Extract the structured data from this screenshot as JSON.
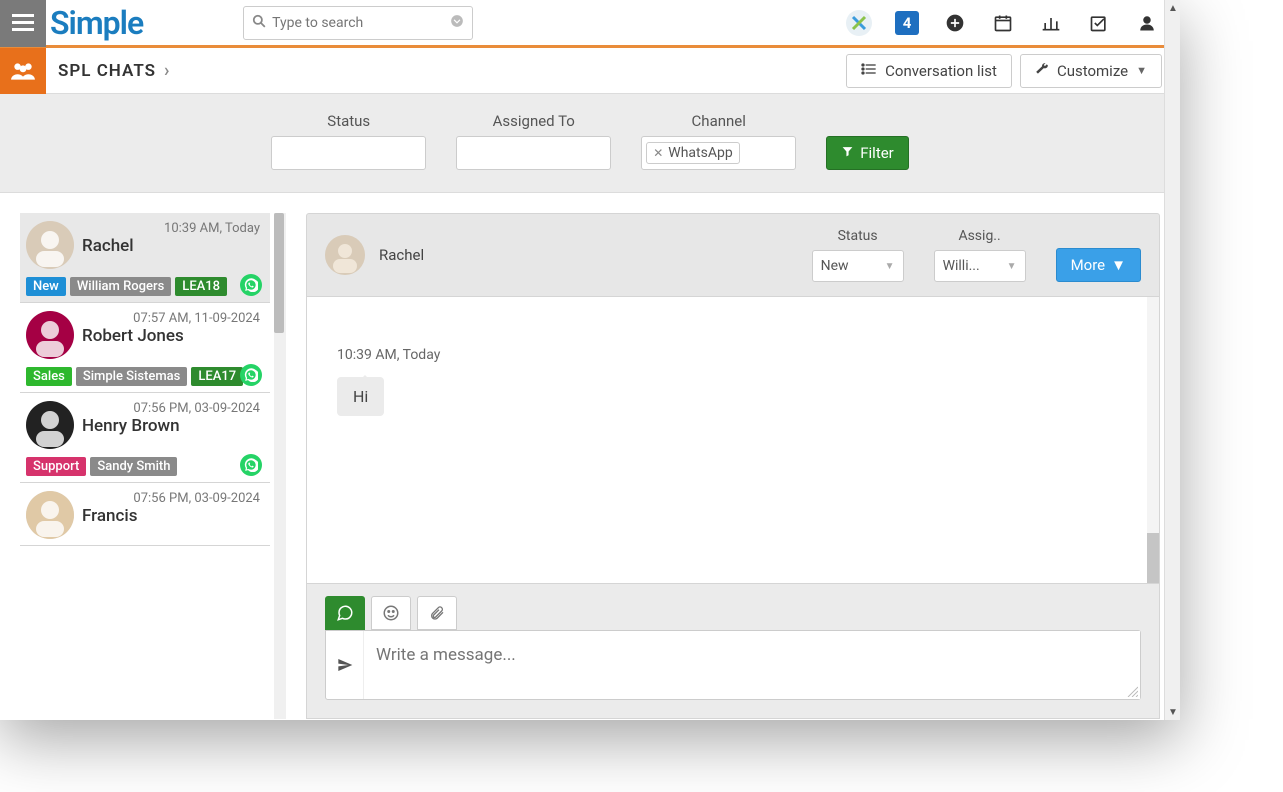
{
  "header": {
    "logo_text": "Simple",
    "search_placeholder": "Type to search"
  },
  "sub_header": {
    "title": "SPL CHATS",
    "conv_list_btn": "Conversation list",
    "customize_btn": "Customize"
  },
  "filters": {
    "status_label": "Status",
    "assigned_label": "Assigned To",
    "channel_label": "Channel",
    "channel_chip": "WhatsApp",
    "filter_btn": "Filter"
  },
  "conversations": [
    {
      "time": "10:39 AM, Today",
      "name": "Rachel",
      "tags": [
        {
          "text": "New",
          "cls": "tag-new"
        },
        {
          "text": "William Rogers",
          "cls": "tag-grey"
        },
        {
          "text": "LEA18",
          "cls": "tag-lea18"
        }
      ],
      "selected": true,
      "wa": true
    },
    {
      "time": "07:57 AM, 11-09-2024",
      "name": "Robert Jones",
      "tags": [
        {
          "text": "Sales",
          "cls": "tag-sales"
        },
        {
          "text": "Simple Sistemas",
          "cls": "tag-grey"
        },
        {
          "text": "LEA17",
          "cls": "tag-lea17"
        }
      ],
      "wa": true
    },
    {
      "time": "07:56 PM, 03-09-2024",
      "name": "Henry Brown",
      "tags": [
        {
          "text": "Support",
          "cls": "tag-support"
        },
        {
          "text": "Sandy Smith",
          "cls": "tag-grey"
        }
      ],
      "wa": true
    },
    {
      "time": "07:56 PM, 03-09-2024",
      "name": "Francis",
      "tags": [],
      "wa": false
    }
  ],
  "chat": {
    "contact_name": "Rachel",
    "status_label": "Status",
    "status_value": "New",
    "assigned_label": "Assig..",
    "assigned_value": "Willi...",
    "more_btn": "More",
    "msg_time": "10:39 AM, Today",
    "msg_text": "Hi",
    "composer_placeholder": "Write a message..."
  },
  "icons": {
    "four": "4"
  }
}
